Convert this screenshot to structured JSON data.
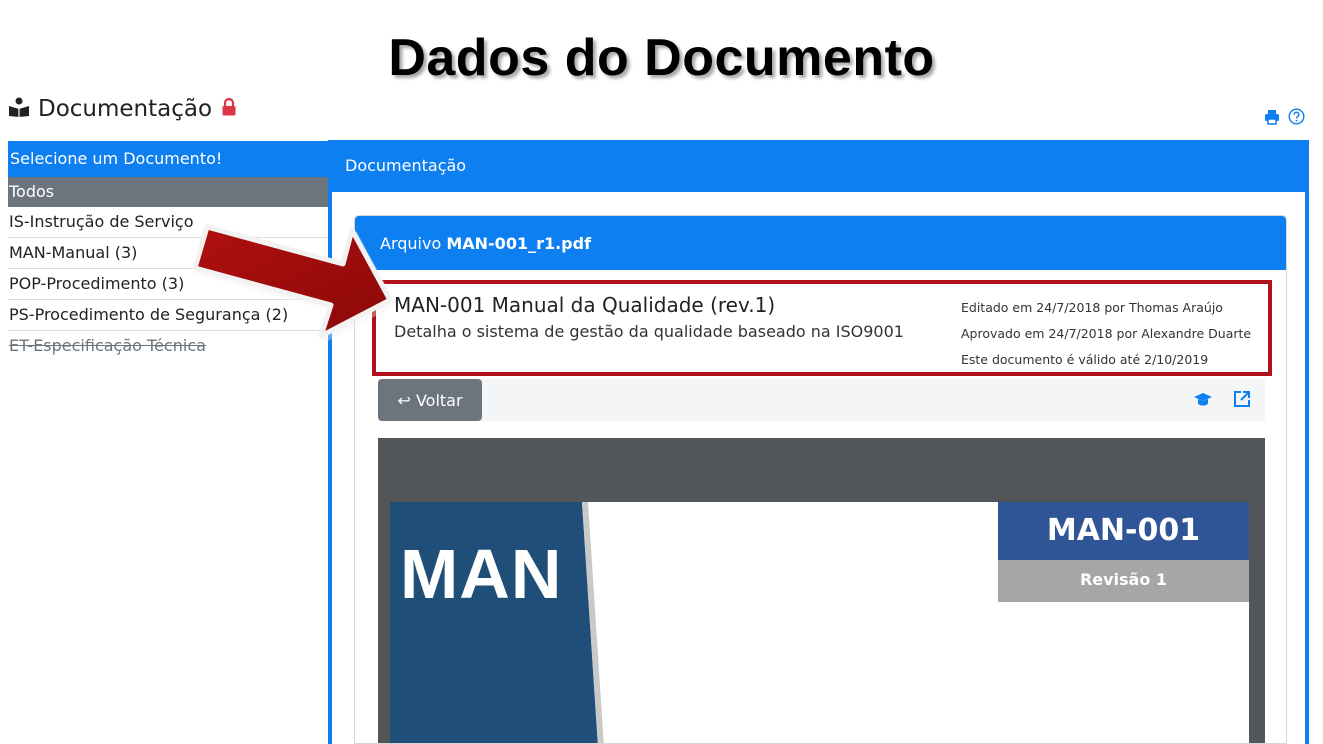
{
  "slide": {
    "title": "Dados do Documento"
  },
  "app": {
    "title": "Documentação",
    "icons": {
      "app": "reader-icon",
      "lock": "lock-icon",
      "print": "print-icon",
      "help": "help-icon"
    }
  },
  "sidebar": {
    "header": "Selecione um Documento!",
    "items": [
      {
        "label": "Todos"
      },
      {
        "label": "IS-Instrução de Serviço"
      },
      {
        "label": "MAN-Manual (3)"
      },
      {
        "label": "POP-Procedimento (3)"
      },
      {
        "label": "PS-Procedimento de Segurança (2)"
      },
      {
        "label": "ET-Especificação Técnica"
      }
    ]
  },
  "main": {
    "panel_title": "Documentação",
    "file_label": "Arquivo",
    "file_name": "MAN-001_r1.pdf",
    "doc": {
      "title": "MAN-001 Manual da Qualidade (rev.1)",
      "description": "Detalha o sistema de gestão da qualidade baseado na ISO9001",
      "edited": "Editado em 24/7/2018 por Thomas Araújo",
      "approved": "Aprovado em 24/7/2018 por Alexandre Duarte",
      "valid": "Este documento é válido até 2/10/2019"
    },
    "back_label": "↩ Voltar",
    "toolbar_icons": [
      "training-icon",
      "open-external-icon"
    ],
    "preview": {
      "band_text": "MAN",
      "code": "MAN-001",
      "revision": "Revisão 1"
    }
  },
  "colors": {
    "primary": "#0d7ff1",
    "secondary": "#6c757d",
    "highlight": "#b0111b",
    "doc_navy": "#2f5597",
    "band": "#1f4e79"
  }
}
